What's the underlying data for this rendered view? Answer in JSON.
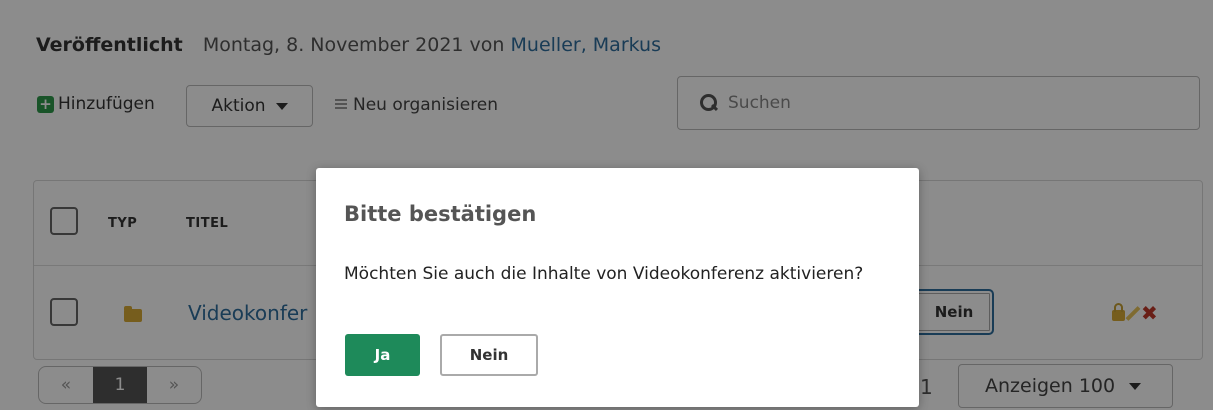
{
  "header": {
    "published_label": "Veröffentlicht",
    "published_text": "Montag, 8. November 2021 von",
    "author": "Mueller, Markus"
  },
  "toolbar": {
    "add_label": "Hinzufügen",
    "action_label": "Aktion",
    "reorganize_label": "Neu organisieren",
    "search_placeholder": "Suchen"
  },
  "table": {
    "columns": [
      "TYP",
      "TITEL"
    ],
    "rows": [
      {
        "type_icon": "folder-icon",
        "title": "Videokonfer",
        "status_button": "Nein"
      }
    ]
  },
  "pagination": {
    "prev": "«",
    "current_page": "1",
    "next": "»",
    "range_text": "1",
    "show_label": "Anzeigen 100"
  },
  "modal": {
    "title": "Bitte bestätigen",
    "message": "Möchten Sie auch die Inhalte von Videokonferenz aktivieren?",
    "yes_label": "Ja",
    "no_label": "Nein"
  },
  "colors": {
    "accent_green": "#1e8a5a",
    "link_blue": "#2f6d9d",
    "delete_red": "#c0392b"
  }
}
